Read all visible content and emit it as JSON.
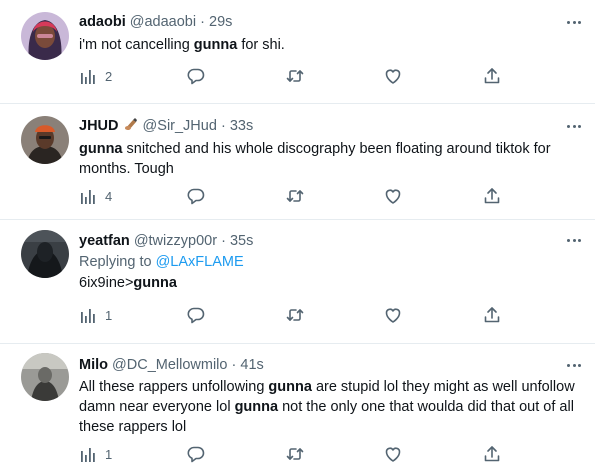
{
  "tweets": [
    {
      "name": "adaobi",
      "handle": "@adaaobi",
      "dot": "·",
      "time": "29s",
      "text_parts": [
        "i'm not cancelling ",
        "gunna",
        " for shi."
      ],
      "views": "2"
    },
    {
      "name": "JHUD",
      "handle": "@Sir_JHud",
      "dot": "·",
      "time": "33s",
      "text_parts": [
        "gunna",
        " snitched and his whole discography been floating around tiktok for months. Tough"
      ],
      "views": "4"
    },
    {
      "name": "yeatfan",
      "handle": "@twizzyp00r",
      "dot": "·",
      "time": "35s",
      "replying_label": "Replying to ",
      "replying_mention": "@LAxFLAME",
      "text_parts": [
        "6ix9ine>",
        "gunna"
      ],
      "views": "1"
    },
    {
      "name": "Milo",
      "handle": "@DC_Mellowmilo",
      "dot": "·",
      "time": "41s",
      "text_parts": [
        "All these rappers unfollowing ",
        "gunna",
        " are stupid lol they might as well unfollow damn near everyone lol ",
        "gunna",
        " not the only one that woulda did that out of all these rappers lol"
      ],
      "views": "1"
    }
  ],
  "icons": {
    "views": "bar-chart-icon",
    "reply": "reply-bubble-icon",
    "retweet": "retweet-icon",
    "like": "heart-icon",
    "share": "share-icon",
    "more": "more-dots-icon",
    "emoji": "writing-hand-emoji"
  },
  "colors": {
    "text": "#0f1419",
    "secondary": "#536471",
    "link": "#1d9bf0",
    "divider": "#e6ecf0"
  }
}
